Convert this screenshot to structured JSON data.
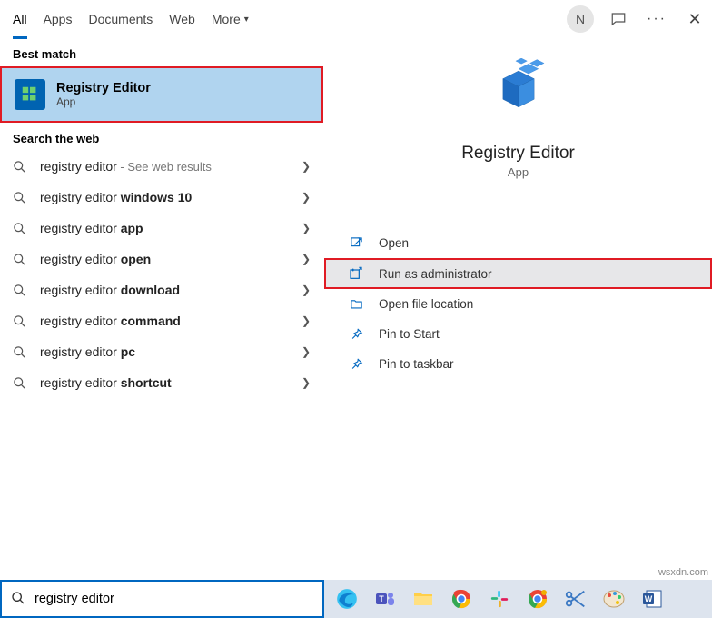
{
  "topbar": {
    "tabs": [
      "All",
      "Apps",
      "Documents",
      "Web",
      "More"
    ],
    "avatar_letter": "N"
  },
  "left": {
    "best_match_label": "Best match",
    "best_match": {
      "title": "Registry Editor",
      "subtitle": "App"
    },
    "search_web_label": "Search the web",
    "web_items": [
      {
        "prefix": "registry editor",
        "bold": "",
        "hint": " - See web results"
      },
      {
        "prefix": "registry editor ",
        "bold": "windows 10",
        "hint": ""
      },
      {
        "prefix": "registry editor ",
        "bold": "app",
        "hint": ""
      },
      {
        "prefix": "registry editor ",
        "bold": "open",
        "hint": ""
      },
      {
        "prefix": "registry editor ",
        "bold": "download",
        "hint": ""
      },
      {
        "prefix": "registry editor ",
        "bold": "command",
        "hint": ""
      },
      {
        "prefix": "registry editor ",
        "bold": "pc",
        "hint": ""
      },
      {
        "prefix": "registry editor ",
        "bold": "shortcut",
        "hint": ""
      }
    ]
  },
  "preview": {
    "title": "Registry Editor",
    "subtitle": "App",
    "actions": [
      {
        "label": "Open",
        "icon": "open"
      },
      {
        "label": "Run as administrator",
        "icon": "admin",
        "highlight": true
      },
      {
        "label": "Open file location",
        "icon": "folder"
      },
      {
        "label": "Pin to Start",
        "icon": "pin"
      },
      {
        "label": "Pin to taskbar",
        "icon": "pin"
      }
    ]
  },
  "search": {
    "value": "registry editor"
  },
  "watermark": "wsxdn.com",
  "taskbar_apps": [
    "edge",
    "teams",
    "explorer",
    "chrome",
    "slack",
    "chrome2",
    "snip",
    "paint",
    "word"
  ]
}
